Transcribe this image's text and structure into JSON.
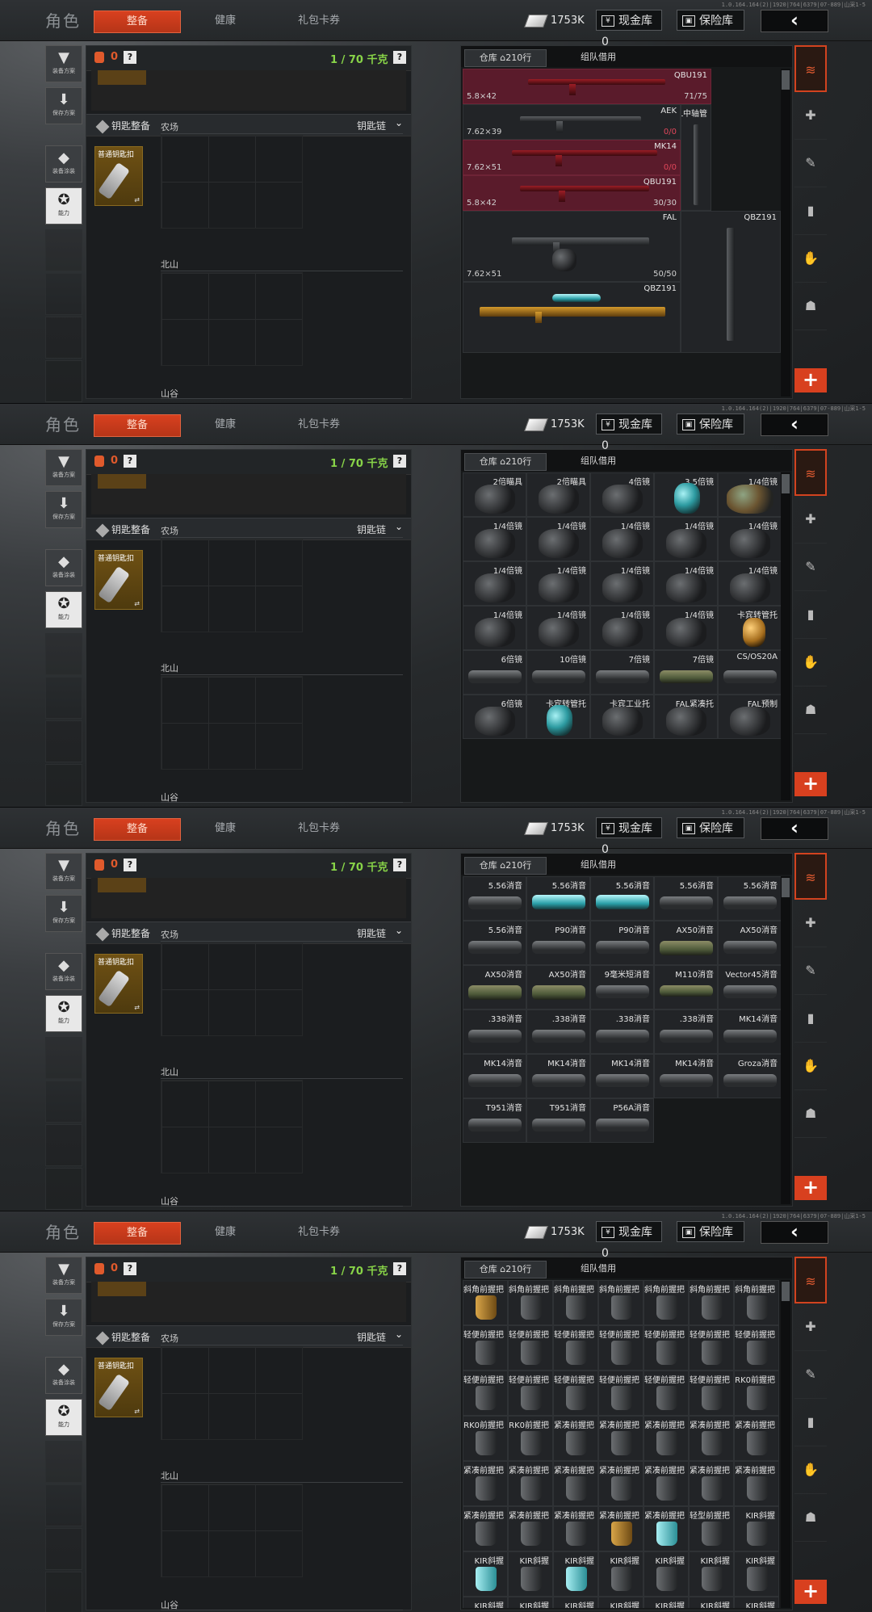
{
  "header": {
    "title": "角色",
    "tabs": [
      "整备",
      "健康",
      "礼包卡券"
    ],
    "cash_value": "1753K",
    "cash_vault_label": "现金库",
    "cash_vault_value": "0",
    "insurance_label": "保险库",
    "back_symbol": "‹",
    "build_text": [
      "1.0.164.164(2)|1920|764|6379|07-889|山采1-5",
      "1.0.164.164(2)|1920|764|6379|07-889|山采1-5",
      "1.0.164.164(2)|1920|764|6379|07-889|山采1-5",
      "1.0.164.164(2)|1920|764|6379|07-889|山采1-5"
    ]
  },
  "left_buttons": [
    {
      "label": "装备方案",
      "icon": "vest-icon"
    },
    {
      "label": "保存方案",
      "icon": "download-icon"
    },
    {
      "label": "装备涂装",
      "icon": "helmet-icon"
    },
    {
      "label": "能力",
      "icon": "ability-icon"
    }
  ],
  "bag": {
    "count": "0",
    "help": "?",
    "weight": "1 / 70 千克",
    "weight_help": "?"
  },
  "keys": {
    "header_label": "钥匙整备",
    "chain_label": "钥匙链",
    "keycard_label": "普通钥匙扣",
    "swap_symbol": "⇄",
    "maps": [
      "农场",
      "北山",
      "山谷"
    ]
  },
  "inventory": {
    "tab_storage": "仓库",
    "tab_storage_count": "210行",
    "tab_team": "组队借用",
    "plus_label": "+"
  },
  "panel1_items": [
    {
      "name": "QBU191",
      "caliber": "5.8×42",
      "count": "71/75",
      "red": true
    },
    {
      "name": "AEK",
      "caliber": "7.62×39",
      "count": "0/0",
      "red": false
    },
    {
      "name": "FAL中轴管",
      "caliber": "",
      "count": "",
      "red": false
    },
    {
      "name": "MK14",
      "caliber": "7.62×51",
      "count": "0/0",
      "red": true
    },
    {
      "name": "QBU191",
      "caliber": "5.8×42",
      "count": "30/30",
      "red": true
    },
    {
      "name": "FAL",
      "caliber": "7.62×51",
      "count": "50/50",
      "red": false
    },
    {
      "name": "QBZ191",
      "caliber": "",
      "count": "",
      "red": false
    },
    {
      "name": "QBZ191",
      "caliber": "",
      "count": "",
      "red": false
    }
  ],
  "panel2_items": [
    "2倍瞄具",
    "2倍瞄具",
    "4倍镜",
    "3.5倍镜",
    "1/4倍镜",
    "1/4倍镜",
    "1/4倍镜",
    "1/4倍镜",
    "1/4倍镜",
    "1/4倍镜",
    "1/4倍镜",
    "1/4倍镜",
    "1/4倍镜",
    "1/4倍镜",
    "1/4倍镜",
    "1/4倍镜",
    "1/4倍镜",
    "1/4倍镜",
    "1/4倍镜",
    "卡宾转管托",
    "6倍镜",
    "10倍镜",
    "7倍镜",
    "7倍镜",
    "CS/OS20A",
    "6倍镜",
    "卡宾转管托",
    "卡宾工业托",
    "FAL紧凑托",
    "FAL预制"
  ],
  "panel3_items": [
    "5.56消音",
    "5.56消音",
    "5.56消音",
    "5.56消音",
    "5.56消音",
    "5.56消音",
    "P90消音",
    "P90消音",
    "AX50消音",
    "AX50消音",
    "AX50消音",
    "AX50消音",
    "9毫米短消音",
    "M110消音",
    "Vector45消音",
    ".338消音",
    ".338消音",
    ".338消音",
    ".338消音",
    "MK14消音",
    "MK14消音",
    "MK14消音",
    "MK14消音",
    "MK14消音",
    "Groza消音",
    "T951消音",
    "T951消音",
    "P56A消音"
  ],
  "panel4_items": [
    "斜角前握把",
    "斜角前握把",
    "斜角前握把",
    "斜角前握把",
    "斜角前握把",
    "斜角前握把",
    "斜角前握把",
    "轻便前握把",
    "轻便前握把",
    "轻便前握把",
    "轻便前握把",
    "轻便前握把",
    "轻便前握把",
    "轻便前握把",
    "轻便前握把",
    "轻便前握把",
    "轻便前握把",
    "轻便前握把",
    "轻便前握把",
    "轻便前握把",
    "RK0前握把",
    "RK0前握把",
    "RK0前握把",
    "紧凑前握把",
    "紧凑前握把",
    "紧凑前握把",
    "紧凑前握把",
    "紧凑前握把",
    "紧凑前握把",
    "紧凑前握把",
    "紧凑前握把",
    "紧凑前握把",
    "紧凑前握把",
    "紧凑前握把",
    "紧凑前握把",
    "紧凑前握把",
    "紧凑前握把",
    "紧凑前握把",
    "紧凑前握把",
    "紧凑前握把",
    "轻型前握把",
    "KIR斜握",
    "KIR斜握",
    "KIR斜握",
    "KIR斜握",
    "KIR斜握",
    "KIR斜握",
    "KIR斜握",
    "KIR斜握",
    "KIR斜握",
    "KIR斜握",
    "KIR斜握",
    "KIR斜握",
    "KIR斜握",
    "KIR斜握",
    "KIR斜握",
    "KIR斜握",
    "KIR斜握",
    "KIR斜握",
    "KIR斜握",
    "KIR斜握",
    "KIR斜握",
    "KIR斜握"
  ],
  "colors": {
    "accent": "#d8401f",
    "weight_green": "#88d448",
    "red_row": "#5a1b2b"
  }
}
